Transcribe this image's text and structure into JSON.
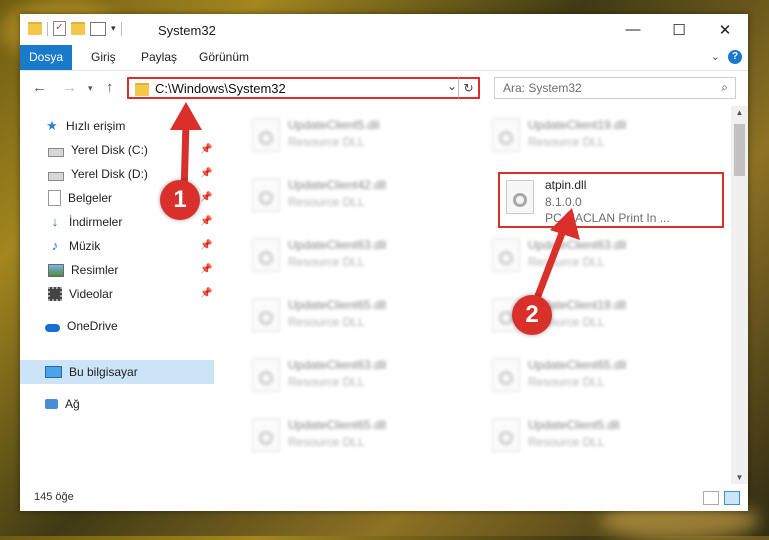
{
  "window": {
    "title": "System32"
  },
  "window_controls": {
    "minimize": "—",
    "maximize": "☐",
    "close": "✕"
  },
  "ribbon": {
    "tabs": [
      "Dosya",
      "Giriş",
      "Paylaş",
      "Görünüm"
    ],
    "active_tab": "Dosya",
    "help": "?"
  },
  "address_bar": {
    "path": "C:\\Windows\\System32"
  },
  "search": {
    "placeholder": "Ara: System32"
  },
  "sidebar": {
    "items": [
      {
        "label": "Hızlı erişim",
        "icon": "star-icon"
      },
      {
        "label": "Yerel Disk (C:)",
        "icon": "disk-icon",
        "pinned": true
      },
      {
        "label": "Yerel Disk (D:)",
        "icon": "disk-icon",
        "pinned": true
      },
      {
        "label": "Belgeler",
        "icon": "documents-icon",
        "pinned": true
      },
      {
        "label": "İndirmeler",
        "icon": "download-icon",
        "pinned": true
      },
      {
        "label": "Müzik",
        "icon": "music-icon",
        "pinned": true
      },
      {
        "label": "Resimler",
        "icon": "pictures-icon",
        "pinned": true
      },
      {
        "label": "Videolar",
        "icon": "videos-icon",
        "pinned": true
      },
      {
        "label": "OneDrive",
        "icon": "onedrive-icon"
      },
      {
        "label": "Bu bilgisayar",
        "icon": "pc-icon",
        "selected": true
      },
      {
        "label": "Ağ",
        "icon": "network-icon"
      }
    ]
  },
  "files": {
    "left_column": [
      {
        "name": "UpdateClient5.dll",
        "desc": "Resource DLL"
      },
      {
        "name": "UpdateClient42.dll",
        "desc": "Resource DLL"
      },
      {
        "name": "UpdateClient63.dll",
        "desc": "Resource DLL"
      },
      {
        "name": "UpdateClient65.dll",
        "desc": "Resource DLL"
      },
      {
        "name": "UpdateClient63.dll",
        "desc": "Resource DLL"
      },
      {
        "name": "UpdateClient65.dll",
        "desc": "Resource DLL"
      }
    ],
    "right_column": [
      {
        "name": "UpdateClient19.dll",
        "desc": "Resource DLL"
      },
      {
        "name": "UpdateClient63.dll",
        "desc": "Resource DLL"
      },
      {
        "name": "UpdateClient19.dll",
        "desc": "Resource DLL"
      },
      {
        "name": "UpdateClient65.dll",
        "desc": "Resource DLL"
      },
      {
        "name": "UpdateClient5.dll",
        "desc": "Resource DLL"
      }
    ],
    "highlighted": {
      "name": "atpin.dll",
      "version": "8.1.0.0",
      "company": "PC MACLAN Print In ..."
    }
  },
  "status": {
    "count": "145 öğe"
  },
  "callouts": [
    "1",
    "2"
  ],
  "colors": {
    "accent": "#1979ca",
    "highlight": "#d9302c",
    "selected": "#cce4f7"
  }
}
